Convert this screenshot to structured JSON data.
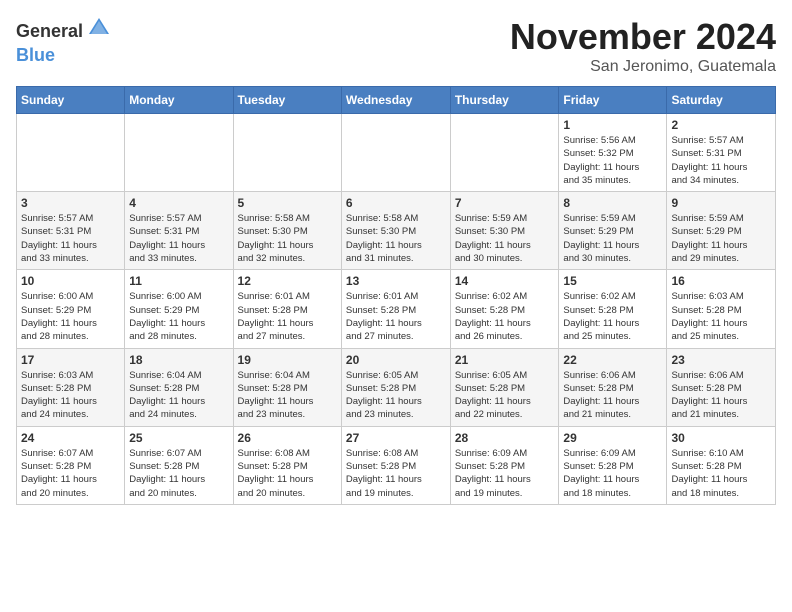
{
  "logo": {
    "general": "General",
    "blue": "Blue",
    "tagline": ""
  },
  "title": "November 2024",
  "location": "San Jeronimo, Guatemala",
  "weekdays": [
    "Sunday",
    "Monday",
    "Tuesday",
    "Wednesday",
    "Thursday",
    "Friday",
    "Saturday"
  ],
  "weeks": [
    [
      {
        "day": "",
        "info": ""
      },
      {
        "day": "",
        "info": ""
      },
      {
        "day": "",
        "info": ""
      },
      {
        "day": "",
        "info": ""
      },
      {
        "day": "",
        "info": ""
      },
      {
        "day": "1",
        "info": "Sunrise: 5:56 AM\nSunset: 5:32 PM\nDaylight: 11 hours\nand 35 minutes."
      },
      {
        "day": "2",
        "info": "Sunrise: 5:57 AM\nSunset: 5:31 PM\nDaylight: 11 hours\nand 34 minutes."
      }
    ],
    [
      {
        "day": "3",
        "info": "Sunrise: 5:57 AM\nSunset: 5:31 PM\nDaylight: 11 hours\nand 33 minutes."
      },
      {
        "day": "4",
        "info": "Sunrise: 5:57 AM\nSunset: 5:31 PM\nDaylight: 11 hours\nand 33 minutes."
      },
      {
        "day": "5",
        "info": "Sunrise: 5:58 AM\nSunset: 5:30 PM\nDaylight: 11 hours\nand 32 minutes."
      },
      {
        "day": "6",
        "info": "Sunrise: 5:58 AM\nSunset: 5:30 PM\nDaylight: 11 hours\nand 31 minutes."
      },
      {
        "day": "7",
        "info": "Sunrise: 5:59 AM\nSunset: 5:30 PM\nDaylight: 11 hours\nand 30 minutes."
      },
      {
        "day": "8",
        "info": "Sunrise: 5:59 AM\nSunset: 5:29 PM\nDaylight: 11 hours\nand 30 minutes."
      },
      {
        "day": "9",
        "info": "Sunrise: 5:59 AM\nSunset: 5:29 PM\nDaylight: 11 hours\nand 29 minutes."
      }
    ],
    [
      {
        "day": "10",
        "info": "Sunrise: 6:00 AM\nSunset: 5:29 PM\nDaylight: 11 hours\nand 28 minutes."
      },
      {
        "day": "11",
        "info": "Sunrise: 6:00 AM\nSunset: 5:29 PM\nDaylight: 11 hours\nand 28 minutes."
      },
      {
        "day": "12",
        "info": "Sunrise: 6:01 AM\nSunset: 5:28 PM\nDaylight: 11 hours\nand 27 minutes."
      },
      {
        "day": "13",
        "info": "Sunrise: 6:01 AM\nSunset: 5:28 PM\nDaylight: 11 hours\nand 27 minutes."
      },
      {
        "day": "14",
        "info": "Sunrise: 6:02 AM\nSunset: 5:28 PM\nDaylight: 11 hours\nand 26 minutes."
      },
      {
        "day": "15",
        "info": "Sunrise: 6:02 AM\nSunset: 5:28 PM\nDaylight: 11 hours\nand 25 minutes."
      },
      {
        "day": "16",
        "info": "Sunrise: 6:03 AM\nSunset: 5:28 PM\nDaylight: 11 hours\nand 25 minutes."
      }
    ],
    [
      {
        "day": "17",
        "info": "Sunrise: 6:03 AM\nSunset: 5:28 PM\nDaylight: 11 hours\nand 24 minutes."
      },
      {
        "day": "18",
        "info": "Sunrise: 6:04 AM\nSunset: 5:28 PM\nDaylight: 11 hours\nand 24 minutes."
      },
      {
        "day": "19",
        "info": "Sunrise: 6:04 AM\nSunset: 5:28 PM\nDaylight: 11 hours\nand 23 minutes."
      },
      {
        "day": "20",
        "info": "Sunrise: 6:05 AM\nSunset: 5:28 PM\nDaylight: 11 hours\nand 23 minutes."
      },
      {
        "day": "21",
        "info": "Sunrise: 6:05 AM\nSunset: 5:28 PM\nDaylight: 11 hours\nand 22 minutes."
      },
      {
        "day": "22",
        "info": "Sunrise: 6:06 AM\nSunset: 5:28 PM\nDaylight: 11 hours\nand 21 minutes."
      },
      {
        "day": "23",
        "info": "Sunrise: 6:06 AM\nSunset: 5:28 PM\nDaylight: 11 hours\nand 21 minutes."
      }
    ],
    [
      {
        "day": "24",
        "info": "Sunrise: 6:07 AM\nSunset: 5:28 PM\nDaylight: 11 hours\nand 20 minutes."
      },
      {
        "day": "25",
        "info": "Sunrise: 6:07 AM\nSunset: 5:28 PM\nDaylight: 11 hours\nand 20 minutes."
      },
      {
        "day": "26",
        "info": "Sunrise: 6:08 AM\nSunset: 5:28 PM\nDaylight: 11 hours\nand 20 minutes."
      },
      {
        "day": "27",
        "info": "Sunrise: 6:08 AM\nSunset: 5:28 PM\nDaylight: 11 hours\nand 19 minutes."
      },
      {
        "day": "28",
        "info": "Sunrise: 6:09 AM\nSunset: 5:28 PM\nDaylight: 11 hours\nand 19 minutes."
      },
      {
        "day": "29",
        "info": "Sunrise: 6:09 AM\nSunset: 5:28 PM\nDaylight: 11 hours\nand 18 minutes."
      },
      {
        "day": "30",
        "info": "Sunrise: 6:10 AM\nSunset: 5:28 PM\nDaylight: 11 hours\nand 18 minutes."
      }
    ]
  ]
}
